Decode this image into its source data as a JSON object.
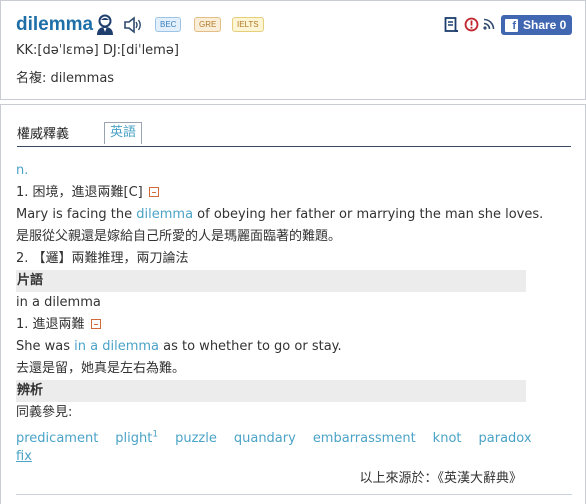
{
  "header": {
    "headword": "dilemma",
    "tags": [
      "BEC",
      "GRE",
      "IELTS"
    ],
    "share_label": "Share 0",
    "fb_letter": "f",
    "pronunciation": "KK:[dəˈlɛmə] DJ:[diˈlemə]",
    "plural": "名複: dilemmas",
    "icons": [
      "person-icon",
      "speaker-icon",
      "book-icon",
      "report-icon",
      "rss-icon",
      "facebook-icon"
    ]
  },
  "tabs": {
    "section_title": "權威釋義",
    "active_tab": "英語"
  },
  "entry": {
    "pos": "n.",
    "sense1": "1. 困境，進退兩難[C]",
    "example1_pre": "Mary is facing the ",
    "example1_kw": "dilemma",
    "example1_post": " of obeying her father or marrying the man she loves.",
    "example1_zh": "是服從父親還是嫁給自己所愛的人是瑪麗面臨著的難題。",
    "sense2": "2. 【邏】兩難推理，兩刀論法",
    "phrases_title": "片語",
    "phrase": "in a dilemma",
    "phrase_sense": "1. 進退兩難",
    "example2_pre": "She was ",
    "example2_kw": "in a dilemma",
    "example2_post": " as to whether to go or stay.",
    "example2_zh": "去還是留，她真是左右為難。",
    "analysis_title": "辨析",
    "synonym_label": "同義參見:",
    "synonyms": [
      "predicament",
      "plight",
      "puzzle",
      "quandary",
      "embarrassment",
      "knot",
      "paradox",
      "fix"
    ],
    "plight_sup": "1",
    "source": "以上來源於：《英漢大辭典》"
  },
  "colors": {
    "headword": "#1e6fa8",
    "link": "#4ba3c7",
    "fold": "#d06a3a",
    "facebook": "#4267b2"
  }
}
